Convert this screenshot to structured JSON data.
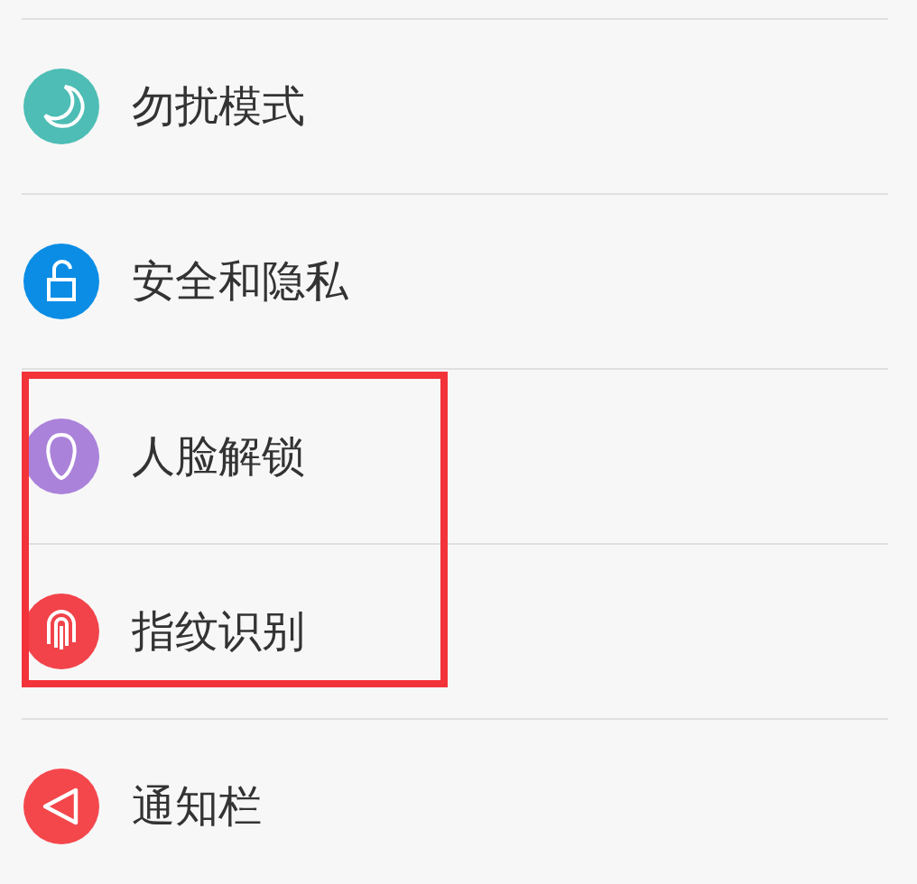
{
  "items": [
    {
      "kind": "moon",
      "label": "勿扰模式",
      "color": "#4dbdb5",
      "highlighted": false
    },
    {
      "kind": "lock",
      "label": "安全和隐私",
      "color": "#0b8de6",
      "highlighted": false
    },
    {
      "kind": "face",
      "label": "人脸解锁",
      "color": "#ab82da",
      "highlighted": true
    },
    {
      "kind": "fingerprint",
      "label": "指纹识别",
      "color": "#f2434a",
      "highlighted": true
    },
    {
      "kind": "triangle",
      "label": "通知栏",
      "color": "#f4474c",
      "highlighted": false
    }
  ]
}
